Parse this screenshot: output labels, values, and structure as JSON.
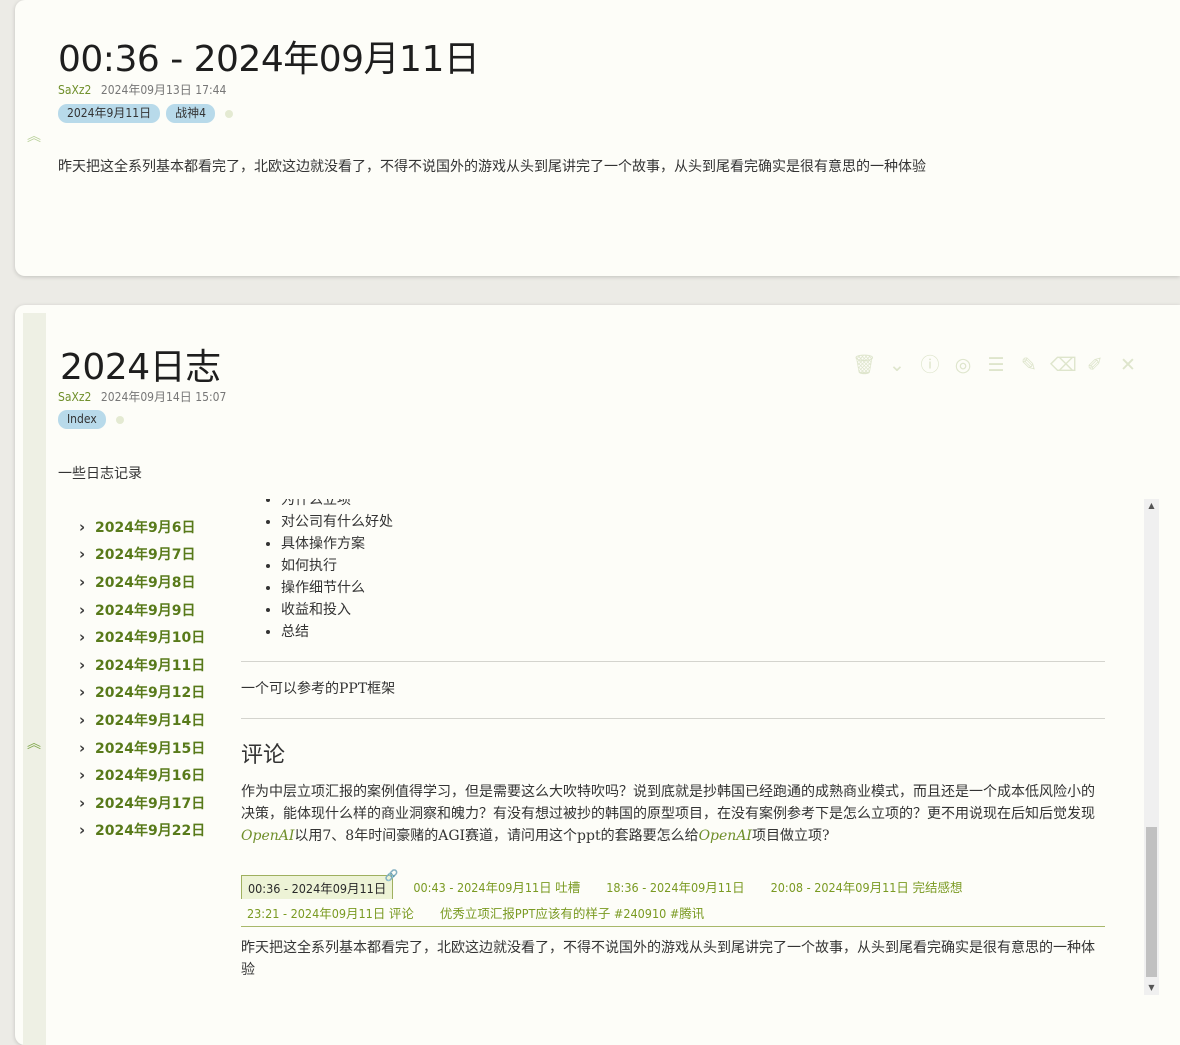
{
  "tiddler1": {
    "title": "00:36 - 2024年09月11日",
    "author": "SaXz2",
    "date": "2024年09月13日 17:44",
    "tags": [
      "2024年9月11日",
      "战神4"
    ],
    "body": "昨天把这全系列基本都看完了，北欧这边就没看了，不得不说国外的游戏从头到尾讲完了一个故事，从头到尾看完确实是很有意思的一种体验"
  },
  "tiddler2": {
    "title": "2024日志",
    "author": "SaXz2",
    "date": "2024年09月14日 15:07",
    "tags": [
      "Index"
    ],
    "intro": "一些日志记录",
    "toolbar": [
      "delete-icon",
      "more-icon",
      "info-icon",
      "focus-icon",
      "list-icon",
      "highlighter-icon",
      "eraser-icon",
      "edit-icon",
      "close-icon"
    ],
    "toc": [
      "2024年9月6日",
      "2024年9月7日",
      "2024年9月8日",
      "2024年9月9日",
      "2024年9月10日",
      "2024年9月11日",
      "2024年9月12日",
      "2024年9月14日",
      "2024年9月15日",
      "2024年9月16日",
      "2024年9月17日",
      "2024年9月22日"
    ],
    "bullets": [
      "为什么立项",
      "对公司有什么好处",
      "具体操作方案",
      "如何执行",
      "操作细节什么",
      "收益和投入",
      "总结"
    ],
    "ppt_note": "一个可以参考的PPT框架",
    "comment_heading": "评论",
    "comment_part1": "作为中层立项汇报的案例值得学习，但是需要这么大吹特吹吗？说到底就是抄韩国已经跑通的成熟商业模式，而且还是一个成本低风险小的决策，能体现什么样的商业洞察和魄力？有没有想过被抄的韩国的原型项目，在没有案例参考下是怎么立项的？更不用说现在后知后觉发现",
    "comment_em1": "OpenAI",
    "comment_part2": "以用7、8年时间豪赌的AGI赛道，请问用这个ppt的套路要怎么给",
    "comment_em2": "OpenAI",
    "comment_part3": "项目做立项?",
    "tabs": [
      "00:36 - 2024年09月11日",
      "00:43 - 2024年09月11日 吐槽",
      "18:36 - 2024年09月11日",
      "20:08 - 2024年09月11日 完结感想",
      "23:21 - 2024年09月11日 评论",
      "优秀立项汇报PPT应该有的样子 #240910 #腾讯"
    ],
    "tab_body": "昨天把这全系列基本都看完了，北欧这边就没看了，不得不说国外的游戏从头到尾讲完了一个故事，从头到尾看完确实是很有意思的一种体验"
  }
}
